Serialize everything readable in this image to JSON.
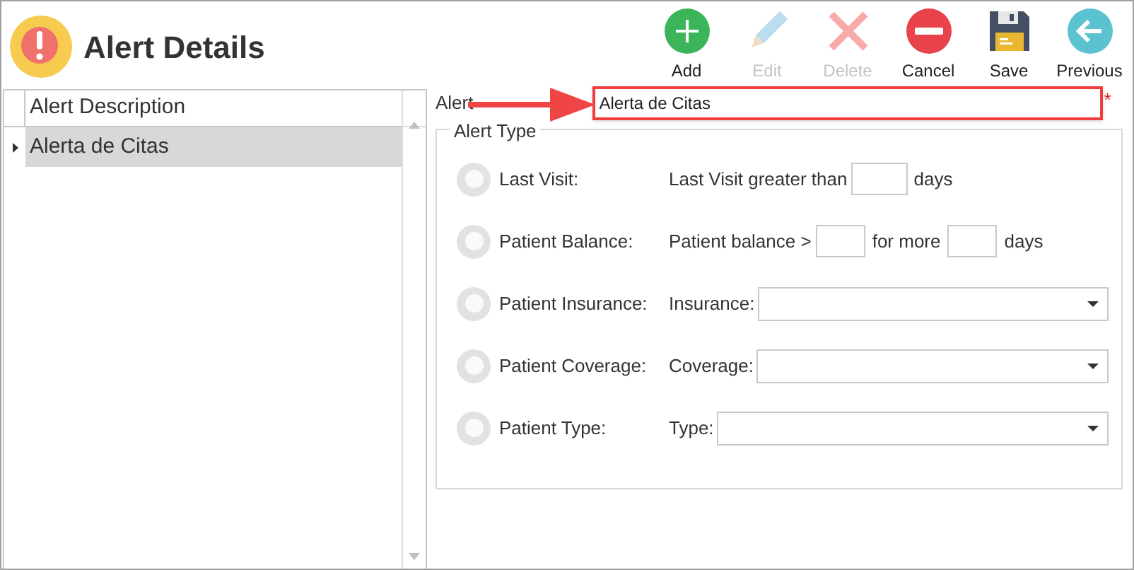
{
  "window": {
    "title": "Alert Details"
  },
  "toolbar": [
    {
      "label": "Add",
      "kind": "add",
      "disabled": false
    },
    {
      "label": "Edit",
      "kind": "edit",
      "disabled": true
    },
    {
      "label": "Delete",
      "kind": "delete",
      "disabled": true
    },
    {
      "label": "Cancel",
      "kind": "cancel",
      "disabled": false
    },
    {
      "label": "Save",
      "kind": "save",
      "disabled": false
    },
    {
      "label": "Previous",
      "kind": "previous",
      "disabled": false
    }
  ],
  "grid": {
    "columns": [
      "Alert Description"
    ],
    "rows": [
      {
        "cells": [
          "Alerta de Citas"
        ],
        "selected": true
      }
    ]
  },
  "description": {
    "label": "Alert",
    "value": "Alerta de Citas",
    "required_mark": "*"
  },
  "alert_type": {
    "legend": "Alert Type",
    "options": [
      {
        "label": "Last Visit:",
        "selected": false,
        "kind": "threshold",
        "parts": [
          "Last Visit greater than",
          "days"
        ]
      },
      {
        "label": "Patient Balance:",
        "selected": false,
        "kind": "balance",
        "parts": [
          "Patient balance >",
          "for more",
          "days"
        ]
      },
      {
        "label": "Patient Insurance:",
        "selected": false,
        "kind": "dropdown",
        "parts": [
          "Insurance:"
        ]
      },
      {
        "label": "Patient Coverage:",
        "selected": false,
        "kind": "dropdown",
        "parts": [
          "Coverage:"
        ]
      },
      {
        "label": "Patient Type:",
        "selected": false,
        "kind": "dropdown",
        "parts": [
          "Type:"
        ]
      }
    ]
  }
}
